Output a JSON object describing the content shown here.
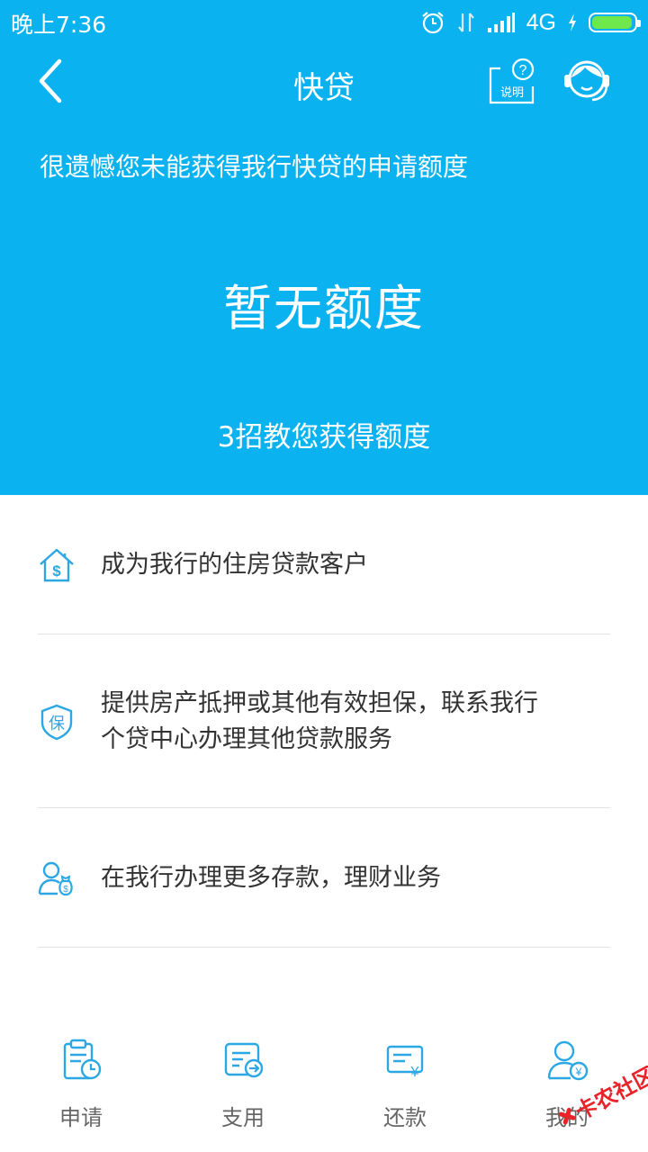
{
  "status_bar": {
    "time": "晚上7:36",
    "network": "4G"
  },
  "nav": {
    "title": "快贷",
    "help_label": "说明"
  },
  "hero": {
    "message": "很遗憾您未能获得我行快贷的申请额度",
    "amount": "暂无额度",
    "tips_link": "3招教您获得额度"
  },
  "tips": [
    {
      "text": "成为我行的住房贷款客户",
      "icon": "house-dollar-icon"
    },
    {
      "text": "提供房产抵押或其他有效担保，联系我行\n个贷中心办理其他贷款服务",
      "icon": "shield-bao-icon",
      "badge": "保"
    },
    {
      "text": "在我行办理更多存款，理财业务",
      "icon": "person-moneybag-icon"
    }
  ],
  "tabs": [
    {
      "label": "申请",
      "icon": "apply-clipboard-icon"
    },
    {
      "label": "支用",
      "icon": "use-card-icon"
    },
    {
      "label": "还款",
      "icon": "repay-yuan-icon"
    },
    {
      "label": "我的",
      "icon": "my-account-icon"
    }
  ],
  "watermark": {
    "text": "卡农社区"
  },
  "colors": {
    "primary": "#0bb2f0",
    "icon": "#2ba7e4",
    "text": "#333333",
    "tab_text": "#666666",
    "watermark": "#e8232a"
  }
}
